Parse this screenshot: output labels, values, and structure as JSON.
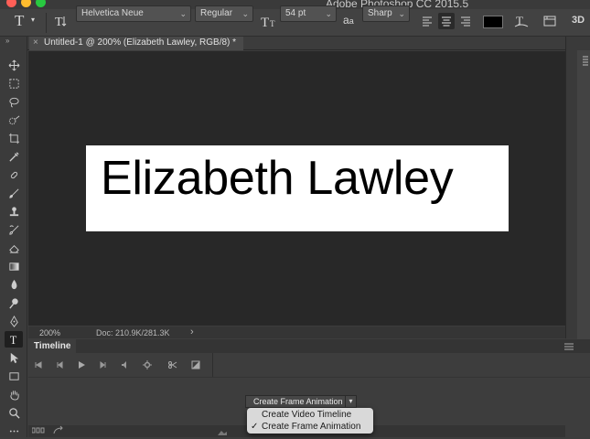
{
  "window": {
    "title": "Adobe Photoshop CC 2015.5"
  },
  "colors": {
    "close": "#ff5f57",
    "minimize": "#febc2e",
    "zoom": "#28c840",
    "canvas_bg": "#282828",
    "document_bg": "#ffffff",
    "text_color_swatch": "#000000"
  },
  "options_bar": {
    "tool_icon": "type-tool-icon",
    "font_family": "Helvetica Neue",
    "font_style": "Regular",
    "font_size": "54 pt",
    "aa_label": "a",
    "aa_small": "a",
    "antialias": "Sharp",
    "warp_icon": "warp-text-icon",
    "panels_icon": "character-panel-icon",
    "threed_label": "3D"
  },
  "tab": {
    "close_glyph": "×",
    "label": "Untitled-1 @ 200% (Elizabeth Lawley, RGB/8) *"
  },
  "document": {
    "text": "Elizabeth Lawley"
  },
  "status": {
    "zoom": "200%",
    "doc_info": "Doc: 210.9K/281.3K",
    "arrow": "›"
  },
  "timeline": {
    "tab_label": "Timeline",
    "create_button": "Create Frame Animation",
    "create_arrow": "▾",
    "menu": [
      {
        "label": "Create Video Timeline",
        "checked": false
      },
      {
        "label": "Create Frame Animation",
        "checked": true
      }
    ],
    "check_glyph": "✓"
  }
}
